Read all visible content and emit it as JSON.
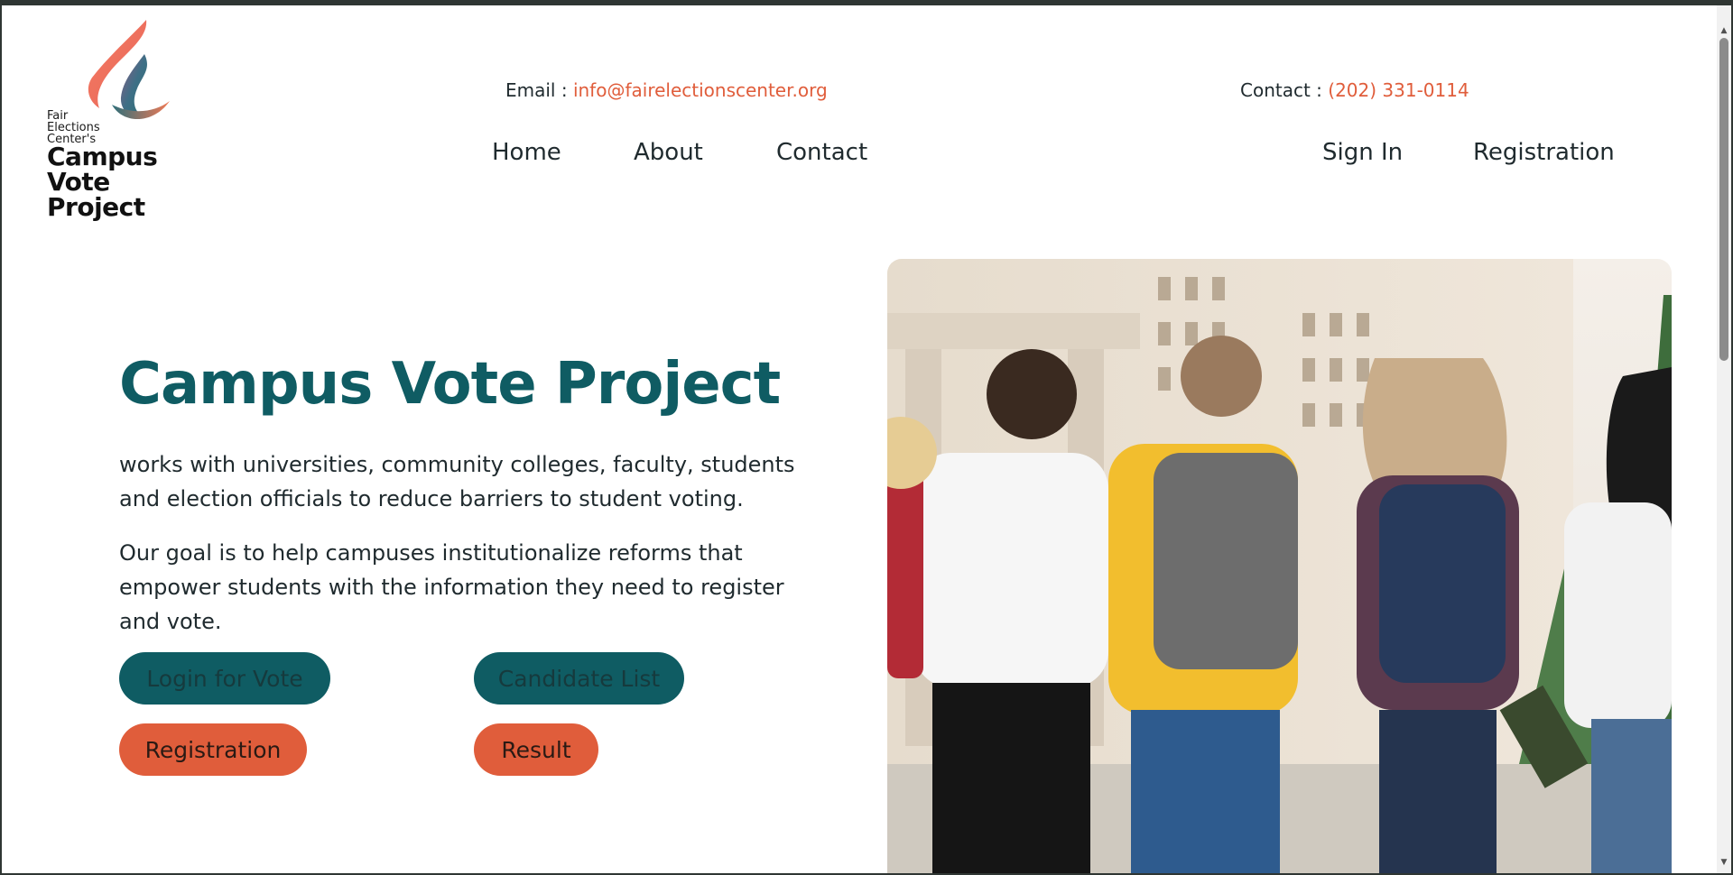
{
  "header": {
    "logo": {
      "small_lines": [
        "Fair",
        "Elections",
        "Center's"
      ],
      "big_lines": [
        "Campus",
        "Vote",
        "Project"
      ]
    },
    "email_label": "Email : ",
    "email_value": "info@fairelectionscenter.org",
    "contact_label": "Contact : ",
    "contact_value": "(202) 331-0114",
    "nav": {
      "home": "Home",
      "about": "About",
      "contact": "Contact",
      "sign_in": "Sign In",
      "registration": "Registration"
    }
  },
  "hero": {
    "title": "Campus Vote Project",
    "paragraph_1": "works with universities, community colleges, faculty, students and election officials to reduce barriers to student voting.",
    "paragraph_2": "Our goal is to help campuses institutionalize reforms that empower students with the information they need to register and vote.",
    "buttons": {
      "login_for_vote": "Login for Vote",
      "candidate_list": "Candidate List",
      "registration": "Registration",
      "result": "Result"
    }
  },
  "colors": {
    "teal": "#0f5c63",
    "orange": "#e05d3b"
  },
  "icons": {
    "scroll_up": "triangle-up",
    "scroll_down": "triangle-down"
  }
}
